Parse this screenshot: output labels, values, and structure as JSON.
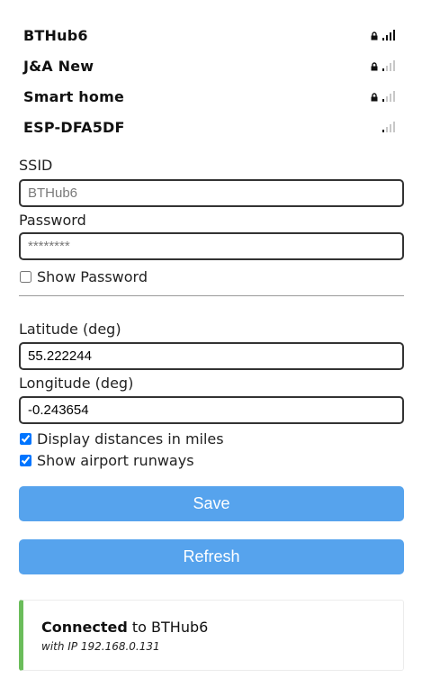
{
  "networks": [
    {
      "ssid": "BTHub6",
      "locked": true,
      "signal": 4
    },
    {
      "ssid": "J&A New",
      "locked": true,
      "signal": 1
    },
    {
      "ssid": "Smart home",
      "locked": true,
      "signal": 1
    },
    {
      "ssid": "ESP-DFA5DF",
      "locked": false,
      "signal": 1
    }
  ],
  "form": {
    "ssid_label": "SSID",
    "ssid_placeholder": "BTHub6",
    "password_label": "Password",
    "password_placeholder": "********",
    "show_password_label": "Show Password",
    "show_password_checked": false,
    "latitude_label": "Latitude (deg)",
    "latitude_value": "55.222244",
    "longitude_label": "Longitude (deg)",
    "longitude_value": "-0.243654",
    "miles_label": "Display distances in miles",
    "miles_checked": true,
    "runways_label": "Show airport runways",
    "runways_checked": true,
    "save_label": "Save",
    "refresh_label": "Refresh"
  },
  "status": {
    "connected_label": "Connected",
    "to_label": " to BTHub6",
    "ip_line": "with IP 192.168.0.131"
  },
  "colors": {
    "button": "#56a3ed",
    "status_accent": "#6bbd5b",
    "signal_on": "#111111",
    "signal_off": "#c8c8c8"
  },
  "icons": {
    "lock": "lock-icon",
    "signal": "wifi-signal-icon"
  }
}
